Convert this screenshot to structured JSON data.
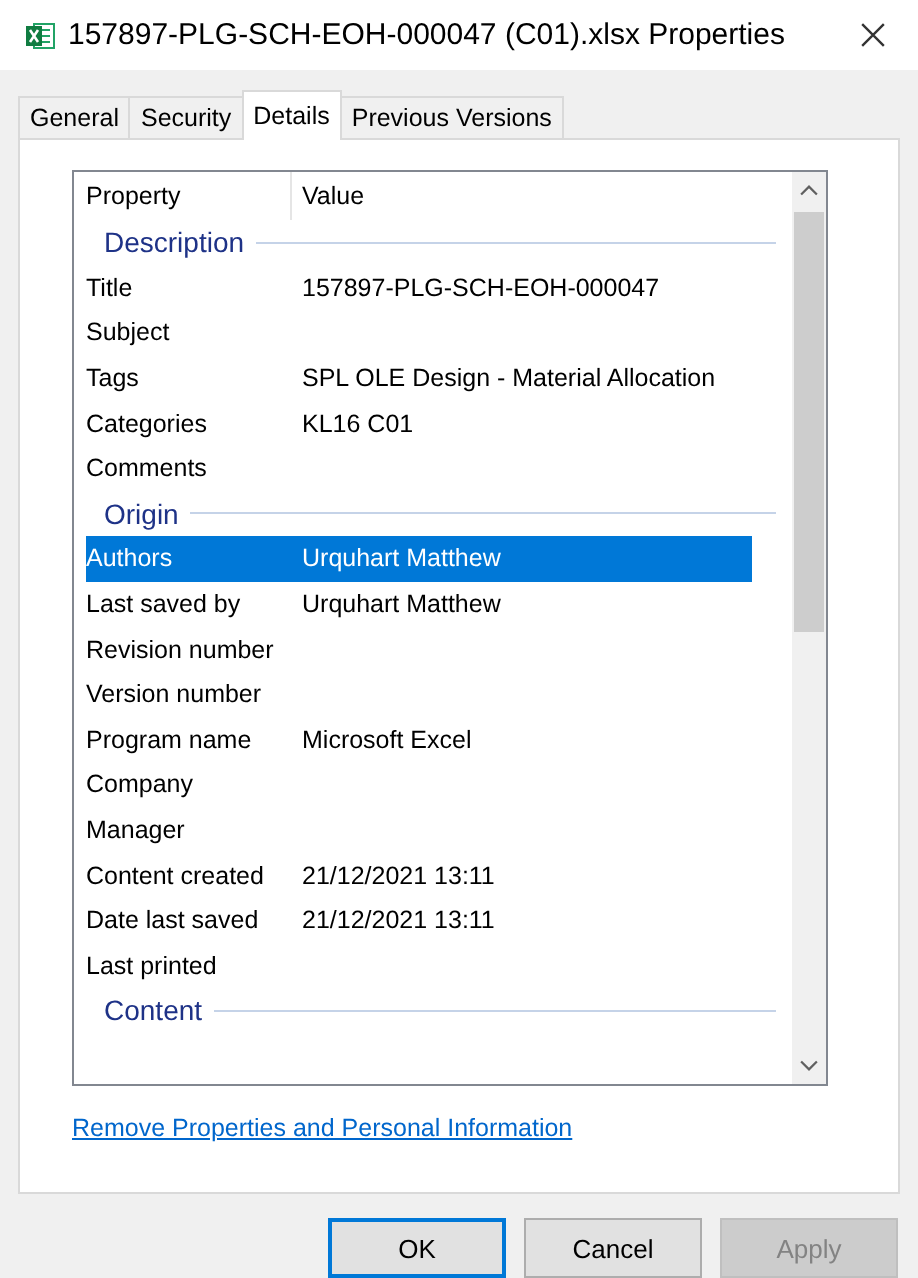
{
  "window": {
    "title": "157897-PLG-SCH-EOH-000047 (C01).xlsx Properties"
  },
  "tabs": [
    {
      "label": "General",
      "selected": false
    },
    {
      "label": "Security",
      "selected": false
    },
    {
      "label": "Details",
      "selected": true
    },
    {
      "label": "Previous Versions",
      "selected": false
    }
  ],
  "columns": [
    "Property",
    "Value"
  ],
  "groups": [
    {
      "name": "Description",
      "properties": [
        {
          "name": "Title",
          "value": "157897-PLG-SCH-EOH-000047",
          "selected": false
        },
        {
          "name": "Subject",
          "selected": false
        },
        {
          "name": "Tags",
          "value": "SPL OLE Design - Material Allocation",
          "selected": false
        },
        {
          "name": "Categories",
          "value": "KL16 C01",
          "selected": false
        },
        {
          "name": "Comments",
          "selected": false
        }
      ]
    },
    {
      "name": "Origin",
      "properties": [
        {
          "name": "Authors",
          "value": "Urquhart Matthew",
          "selected": true
        },
        {
          "name": "Last saved by",
          "value": "Urquhart Matthew",
          "selected": false
        },
        {
          "name": "Revision number",
          "selected": false
        },
        {
          "name": "Version number",
          "selected": false
        },
        {
          "name": "Program name",
          "value": "Microsoft Excel",
          "selected": false
        },
        {
          "name": "Company",
          "selected": false
        },
        {
          "name": "Manager",
          "selected": false
        },
        {
          "name": "Content created",
          "value": "21/12/2021 13:11",
          "selected": false
        },
        {
          "name": "Date last saved",
          "value": "21/12/2021 13:11",
          "selected": false
        },
        {
          "name": "Last printed",
          "selected": false
        }
      ]
    },
    {
      "name": "Content"
    }
  ],
  "link": "Remove Properties and Personal Information",
  "buttons": [
    {
      "label": "OK",
      "default": true,
      "disabled": false
    },
    {
      "label": "Cancel",
      "default": false,
      "disabled": false
    },
    {
      "label": "Apply",
      "default": false,
      "disabled": true
    }
  ]
}
